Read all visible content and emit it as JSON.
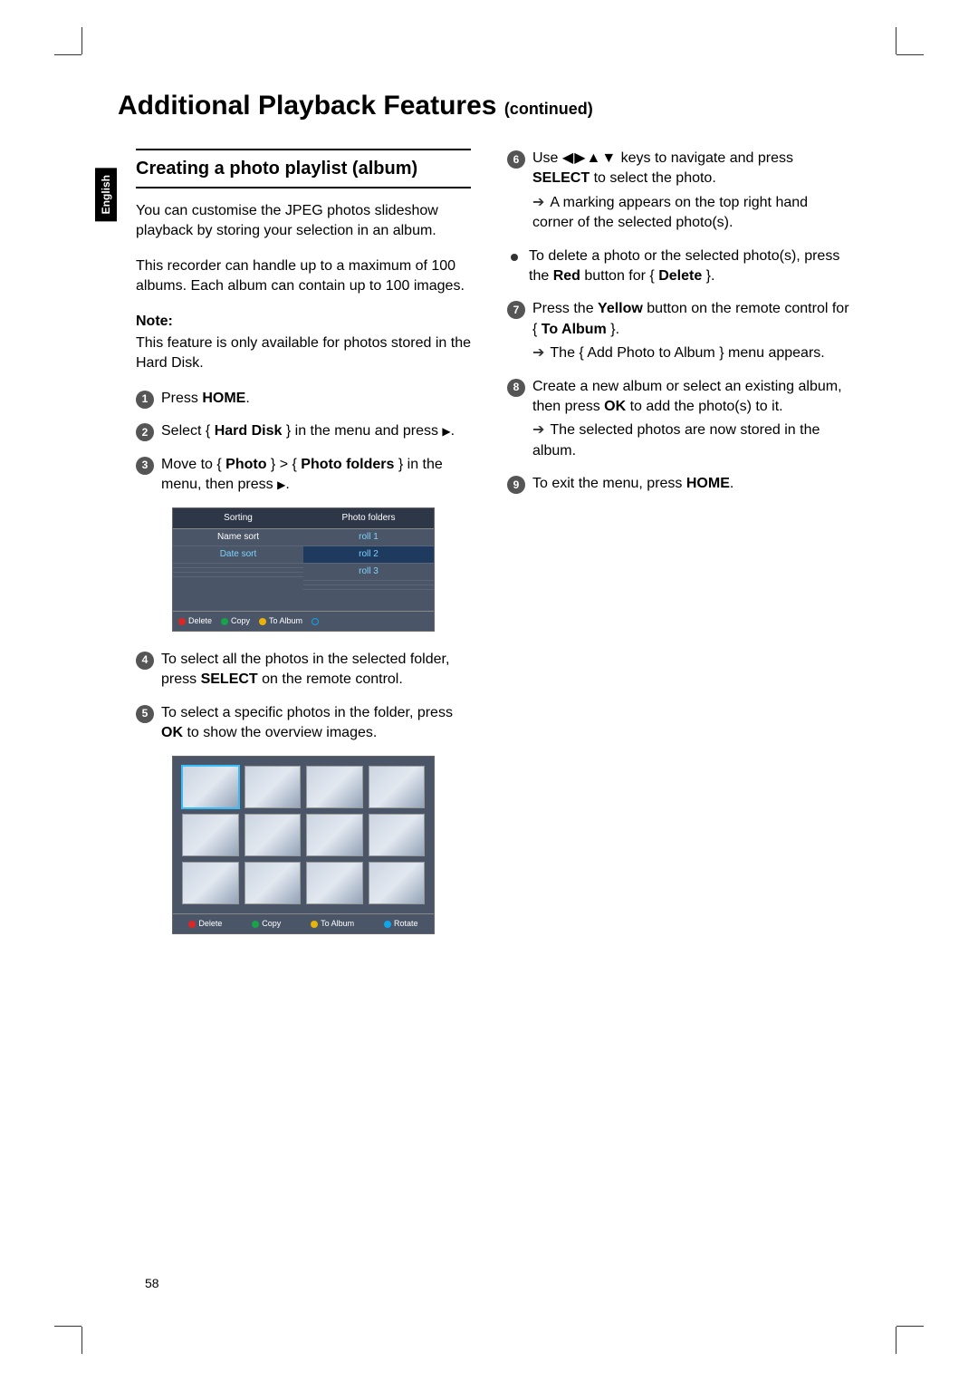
{
  "page_title": "Additional Playback Features",
  "page_title_suffix": "(continued)",
  "language_tab": "English",
  "page_number": "58",
  "left": {
    "section_title": "Creating a photo playlist (album)",
    "intro1": "You can customise the JPEG photos slideshow playback by storing your selection in an album.",
    "intro2": "This recorder can handle up to a maximum of 100 albums.  Each album can contain up to 100 images.",
    "note_label": "Note:",
    "note_text": "This feature is only available for photos stored in the Hard Disk.",
    "step1_pre": "Press ",
    "step1_b": "HOME",
    "step1_post": ".",
    "step2_pre": "Select { ",
    "step2_b": "Hard Disk",
    "step2_mid": " } in the menu and press ",
    "step2_post": ".",
    "step3_pre": "Move to { ",
    "step3_b1": "Photo",
    "step3_mid": " } > { ",
    "step3_b2": "Photo folders",
    "step3_post": " } in the menu, then press ",
    "step3_end": ".",
    "step4_pre": "To select all the photos in the selected folder, press ",
    "step4_b": "SELECT",
    "step4_post": " on the remote control.",
    "step5_pre": "To select a specific photos in the folder, press ",
    "step5_b": "OK",
    "step5_post": " to show the overview images."
  },
  "right": {
    "step6_pre": "Use ",
    "step6_mid": " keys to navigate and press ",
    "step6_b": "SELECT",
    "step6_post": " to select the photo.",
    "step6_result": "A marking appears on the top right hand corner of the selected photo(s).",
    "bullet_pre": "To delete a photo or the selected photo(s), press the ",
    "bullet_b1": "Red",
    "bullet_mid": " button for { ",
    "bullet_b2": "Delete",
    "bullet_post": " }.",
    "step7_pre": "Press the ",
    "step7_b1": "Yellow",
    "step7_mid": " button on the remote control for { ",
    "step7_b2": "To Album",
    "step7_post": " }.",
    "step7_result": "The { Add Photo to Album } menu appears.",
    "step8_pre": "Create a new album or select an existing album, then press ",
    "step8_b": "OK",
    "step8_post": " to add the photo(s) to it.",
    "step8_result": "The selected photos are now stored in the album.",
    "step9_pre": "To exit the menu, press ",
    "step9_b": "HOME",
    "step9_post": "."
  },
  "shot1": {
    "hdr_left": "Sorting",
    "hdr_right": "Photo folders",
    "left_items": [
      "Name sort",
      "Date sort"
    ],
    "right_items": [
      "roll 1",
      "roll 2",
      "roll 3"
    ],
    "footer": {
      "delete": "Delete",
      "copy": "Copy",
      "toalbum": "To Album"
    }
  },
  "shot2": {
    "footer": {
      "delete": "Delete",
      "copy": "Copy",
      "toalbum": "To Album",
      "rotate": "Rotate"
    }
  }
}
